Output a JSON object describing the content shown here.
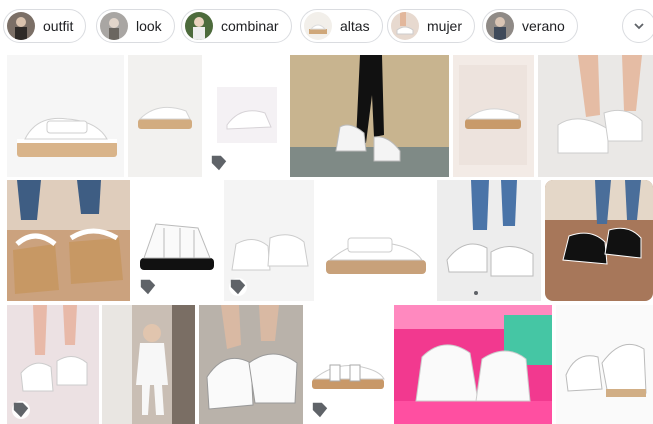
{
  "chips": [
    {
      "label": "outfit",
      "icon": "outfit-thumbnail-icon"
    },
    {
      "label": "look",
      "icon": "look-thumbnail-icon"
    },
    {
      "label": "combinar",
      "icon": "combinar-thumbnail-icon"
    },
    {
      "label": "altas",
      "icon": "altas-thumbnail-icon"
    },
    {
      "label": "mujer",
      "icon": "mujer-thumbnail-icon"
    },
    {
      "label": "verano",
      "icon": "verano-thumbnail-icon"
    }
  ],
  "more_icon": "chevron-down-icon",
  "tag_icon": "price-tag-icon",
  "colors": {
    "chip_border": "#dadce0",
    "text": "#202124",
    "sandal_white": "#ffffff",
    "cork": "#d8b48a"
  }
}
